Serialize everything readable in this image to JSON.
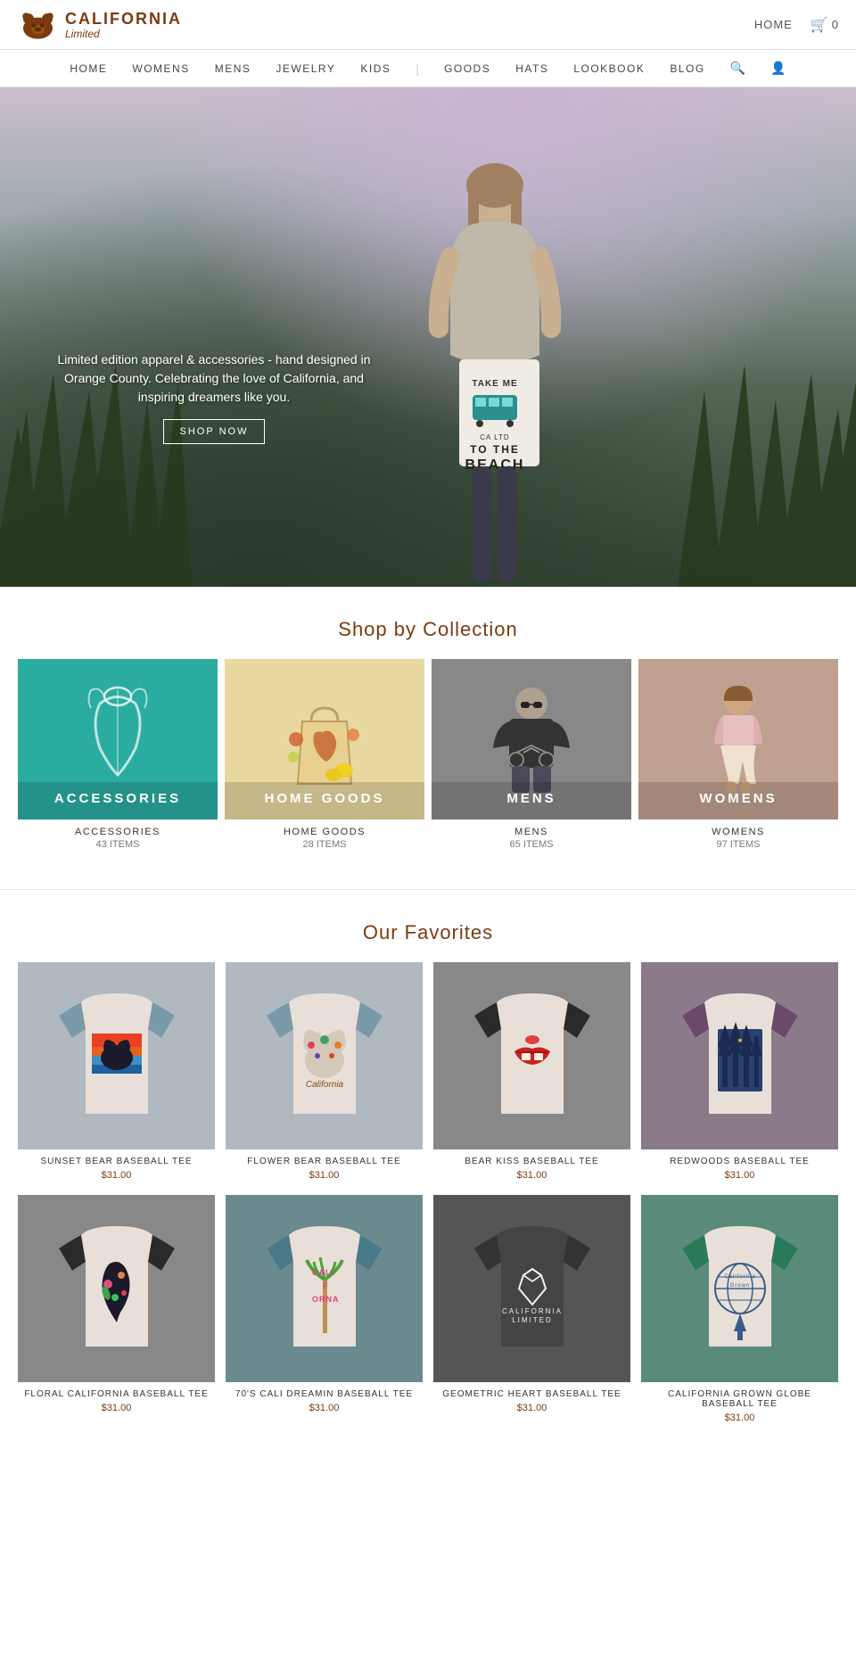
{
  "brand": {
    "california": "CALIFORNIA",
    "limited": "Limited",
    "bear_symbol": "🐻"
  },
  "top_nav": {
    "home": "HOME",
    "cart_icon": "🛒",
    "cart_count": "0"
  },
  "main_nav": {
    "items": [
      {
        "label": "HOME",
        "id": "home"
      },
      {
        "label": "WOMENS",
        "id": "womens"
      },
      {
        "label": "MENS",
        "id": "mens"
      },
      {
        "label": "JEWELRY",
        "id": "jewelry"
      },
      {
        "label": "KIDS",
        "id": "kids"
      },
      {
        "label": "GOODS",
        "id": "goods"
      },
      {
        "label": "HATS",
        "id": "hats"
      },
      {
        "label": "LOOKBOOK",
        "id": "lookbook"
      },
      {
        "label": "BLOG",
        "id": "blog"
      }
    ]
  },
  "hero": {
    "tagline": "Limited edition apparel & accessories - hand designed in Orange County. Celebrating the love of California, and inspiring dreamers like you.",
    "shop_now": "SHOP NOW",
    "beach_line1": "TAKE ME",
    "beach_line2": "TO THE",
    "beach_line3": "BEACH"
  },
  "collections": {
    "section_title": "Shop by Collection",
    "items": [
      {
        "id": "accessories",
        "label": "ACCESSORIES",
        "count": "43 ITEMS",
        "name": "ACCESSORIES"
      },
      {
        "id": "homegoods",
        "label": "HOME GOODS",
        "count": "28 ITEMS",
        "name": "HOME GOODS"
      },
      {
        "id": "mens",
        "label": "MENS",
        "count": "65 ITEMS",
        "name": "MENS"
      },
      {
        "id": "womens",
        "label": "WOMENS",
        "count": "97 ITEMS",
        "name": "WOMENS"
      }
    ]
  },
  "favorites": {
    "section_title": "Our Favorites",
    "products": [
      {
        "name": "SUNSET BEAR BASEBALL TEE",
        "price": "$31.00",
        "id": "sunset-bear",
        "color1": "#7a9aaa",
        "color2": "#e8e0d8"
      },
      {
        "name": "FLOWER BEAR BASEBALL TEE",
        "price": "$31.00",
        "id": "flower-bear",
        "color1": "#7a9aaa",
        "color2": "#e8e0d8"
      },
      {
        "name": "BEAR KISS BASEBALL TEE",
        "price": "$31.00",
        "id": "bear-kiss",
        "color1": "#333",
        "color2": "#e8e0d8"
      },
      {
        "name": "REDWOODS BASEBALL TEE",
        "price": "$31.00",
        "id": "redwoods",
        "color1": "#6a4a6a",
        "color2": "#e8e0d8"
      },
      {
        "name": "FLORAL CALIFORNIA BASEBALL TEE",
        "price": "$31.00",
        "id": "floral-ca",
        "color1": "#333",
        "color2": "#e8e0d8"
      },
      {
        "name": "70'S CALI DREAMIN BASEBALL TEE",
        "price": "$31.00",
        "id": "cali-dreamin",
        "color1": "#4a7a8a",
        "color2": "#e8e0d8"
      },
      {
        "name": "GEOMETRIC HEART BASEBALL TEE",
        "price": "$31.00",
        "id": "geo-heart",
        "color1": "#444",
        "color2": "#555"
      },
      {
        "name": "CALIFORNIA GROWN GLOBE BASEBALL TEE",
        "price": "$31.00",
        "id": "ca-grown",
        "color1": "#2a7a5a",
        "color2": "#e8e0d8"
      }
    ]
  }
}
